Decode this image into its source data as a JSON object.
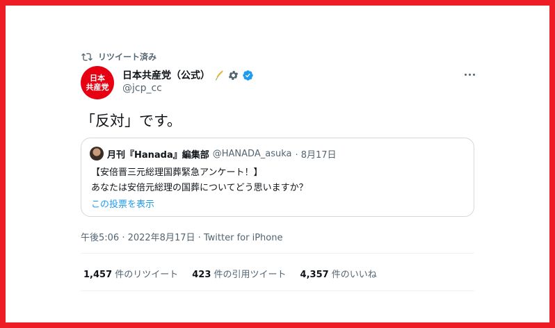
{
  "retweet": {
    "label": "リツイート済み",
    "icon": "retweet-icon"
  },
  "author": {
    "avatar_text_line1": "日本",
    "avatar_text_line2": "共産党",
    "display_name": "日本共産党（公式）",
    "handle": "@jcp_cc",
    "badges": [
      "rice-plant-icon",
      "gear-icon",
      "verified-icon"
    ]
  },
  "tweet": {
    "text": "「反対」です。"
  },
  "quote": {
    "name": "月刊『Hanada』編集部",
    "handle": "@HANADA_asuka",
    "date": "· 8月17日",
    "line1": "【安倍晋三元総理国葬緊急アンケート！】",
    "line2": "あなたは安倍元総理の国葬についてどう思いますか？",
    "link": "この投票を表示"
  },
  "timestamp": "午後5:06 · 2022年8月17日 · Twitter for iPhone",
  "stats": {
    "retweets_count": "1,457",
    "retweets_label": " 件のリツイート",
    "quotes_count": "423",
    "quotes_label": " 件の引用ツイート",
    "likes_count": "4,357",
    "likes_label": " 件のいいね"
  },
  "colors": {
    "frame": "#ee1c25",
    "link": "#1d9bf0",
    "verified": "#1d9bf0",
    "avatar_bg": "#e60012"
  }
}
